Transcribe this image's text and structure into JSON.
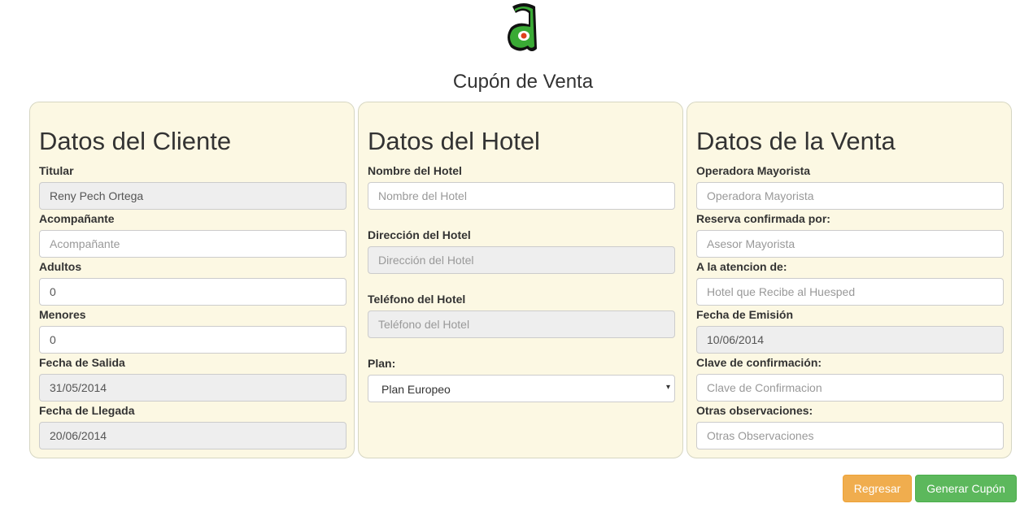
{
  "logo": {
    "letter": "a",
    "colors": {
      "fill": "#3aaa35",
      "outline": "#111111",
      "eye": "#e0401e"
    }
  },
  "page_title": "Cupón de Venta",
  "client": {
    "heading": "Datos del Cliente",
    "titular_label": "Titular",
    "titular_value": "Reny Pech Ortega",
    "acompanante_label": "Acompañante",
    "acompanante_placeholder": "Acompañante",
    "adultos_label": "Adultos",
    "adultos_value": "0",
    "menores_label": "Menores",
    "menores_value": "0",
    "salida_label": "Fecha de Salida",
    "salida_value": "31/05/2014",
    "llegada_label": "Fecha de Llegada",
    "llegada_value": "20/06/2014"
  },
  "hotel": {
    "heading": "Datos del Hotel",
    "nombre_label": "Nombre del Hotel",
    "nombre_placeholder": "Nombre del Hotel",
    "direccion_label": "Dirección del Hotel",
    "direccion_placeholder": "Dirección del Hotel",
    "telefono_label": "Teléfono del Hotel",
    "telefono_placeholder": "Teléfono del Hotel",
    "plan_label": "Plan:",
    "plan_selected": "Plan Europeo",
    "caret": "▾"
  },
  "sale": {
    "heading": "Datos de la Venta",
    "operadora_label": "Operadora Mayorista",
    "operadora_placeholder": "Operadora Mayorista",
    "reserva_label": "Reserva confirmada por:",
    "reserva_placeholder": "Asesor Mayorista",
    "atencion_label": "A la atencion de:",
    "atencion_placeholder": "Hotel que Recibe al Huesped",
    "emision_label": "Fecha de Emisión",
    "emision_value": "10/06/2014",
    "clave_label": "Clave de confirmación:",
    "clave_placeholder": "Clave de Confirmacion",
    "observ_label": "Otras observaciones:",
    "observ_placeholder": "Otras Observaciones"
  },
  "actions": {
    "back_label": "Regresar",
    "generate_label": "Generar Cupón",
    "colors": {
      "warning": "#f0ad4e",
      "success": "#5cb85c"
    }
  },
  "panel_bg": "#fcf8e3"
}
